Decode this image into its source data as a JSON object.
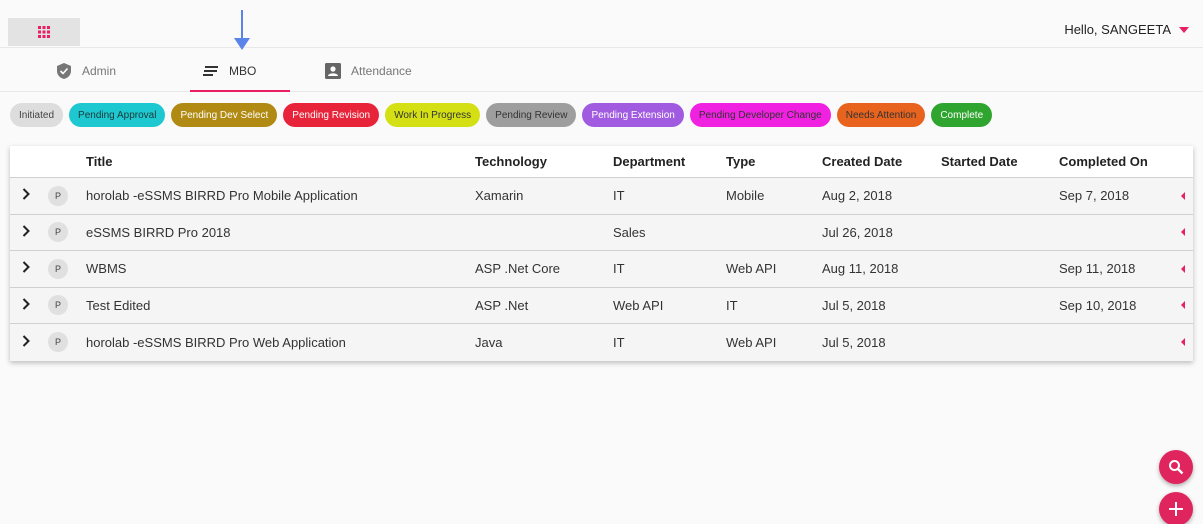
{
  "header": {
    "greeting": "Hello, SANGEETA",
    "apps_icon": "apps-grid-icon"
  },
  "tabs": [
    {
      "label": "Admin",
      "icon": "shield-icon"
    },
    {
      "label": "MBO",
      "icon": "list-lines-icon",
      "active": true
    },
    {
      "label": "Attendance",
      "icon": "contact-card-icon"
    }
  ],
  "status_chips": [
    {
      "label": "Initiated",
      "bg": "#dddddd",
      "fg": "#444444"
    },
    {
      "label": "Pending Approval",
      "bg": "#1ec8d0",
      "fg": "#1a3a3a"
    },
    {
      "label": "Pending Dev Select",
      "bg": "#b08a12",
      "fg": "#ffffff"
    },
    {
      "label": "Pending Revision",
      "bg": "#e8243a",
      "fg": "#ffffff"
    },
    {
      "label": "Work In Progress",
      "bg": "#d4e014",
      "fg": "#333333"
    },
    {
      "label": "Pending Review",
      "bg": "#9e9e9e",
      "fg": "#333333"
    },
    {
      "label": "Pending Extension",
      "bg": "#a05be0",
      "fg": "#ffffff"
    },
    {
      "label": "Pending Developer Change",
      "bg": "#f021e0",
      "fg": "#333333"
    },
    {
      "label": "Needs Attention",
      "bg": "#e8631e",
      "fg": "#333333"
    },
    {
      "label": "Complete",
      "bg": "#2fa52f",
      "fg": "#ffffff"
    }
  ],
  "table": {
    "columns": [
      "Title",
      "Technology",
      "Department",
      "Type",
      "Created Date",
      "Started Date",
      "Completed On"
    ],
    "rows": [
      {
        "badge": "P",
        "title": "horolab -eSSMS BIRRD Pro Mobile Application",
        "technology": "Xamarin",
        "department": "IT",
        "type": "Mobile",
        "created": "Aug 2, 2018",
        "started": "",
        "completed": "Sep 7, 2018"
      },
      {
        "badge": "P",
        "title": "eSSMS BIRRD Pro 2018",
        "technology": "",
        "department": "Sales",
        "type": "",
        "created": "Jul 26, 2018",
        "started": "",
        "completed": ""
      },
      {
        "badge": "P",
        "title": "WBMS",
        "technology": "ASP .Net Core",
        "department": "IT",
        "type": "Web API",
        "created": "Aug 11, 2018",
        "started": "",
        "completed": "Sep 11, 2018"
      },
      {
        "badge": "P",
        "title": "Test Edited",
        "technology": "ASP .Net",
        "department": "Web API",
        "type": "IT",
        "created": "Jul 5, 2018",
        "started": "",
        "completed": "Sep 10, 2018"
      },
      {
        "badge": "P",
        "title": "horolab -eSSMS BIRRD Pro Web Application",
        "technology": "Java",
        "department": "IT",
        "type": "Web API",
        "created": "Jul 5, 2018",
        "started": "",
        "completed": ""
      }
    ]
  },
  "fabs": [
    {
      "icon": "search-icon"
    },
    {
      "icon": "plus-icon"
    }
  ],
  "colors": {
    "accent": "#e91e63",
    "annotation_arrow": "#5b84e8"
  }
}
